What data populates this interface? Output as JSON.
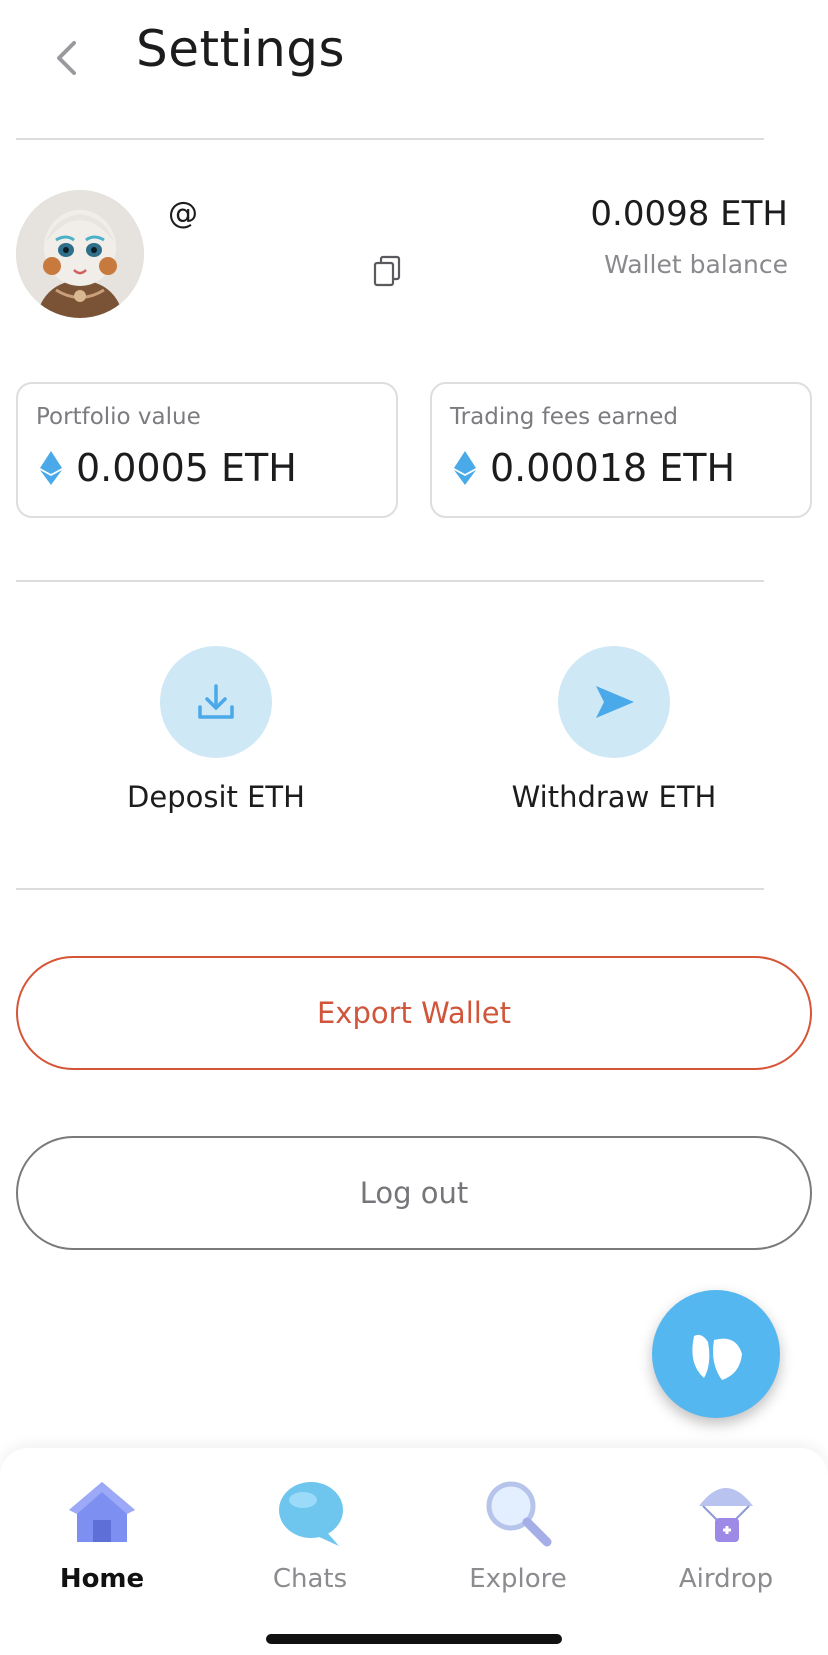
{
  "header": {
    "title": "Settings",
    "back_icon": "chevron-left-icon"
  },
  "profile": {
    "handle": "@",
    "avatar": "avatar-image",
    "copy_icon": "copy-icon",
    "balance_value": "0.0098 ETH",
    "balance_label": "Wallet balance"
  },
  "stats": [
    {
      "label": "Portfolio value",
      "value": "0.0005 ETH",
      "icon": "eth-icon"
    },
    {
      "label": "Trading fees earned",
      "value": "0.00018 ETH",
      "icon": "eth-icon"
    }
  ],
  "actions": {
    "deposit_label": "Deposit ETH",
    "deposit_icon": "download-icon",
    "withdraw_label": "Withdraw ETH",
    "withdraw_icon": "send-icon"
  },
  "buttons": {
    "export_label": "Export Wallet",
    "logout_label": "Log out"
  },
  "fab": {
    "icon": "app-logo-icon"
  },
  "tabbar": {
    "items": [
      {
        "label": "Home",
        "icon": "home-icon",
        "active": true
      },
      {
        "label": "Chats",
        "icon": "chat-bubble-icon",
        "active": false
      },
      {
        "label": "Explore",
        "icon": "magnifier-icon",
        "active": false
      },
      {
        "label": "Airdrop",
        "icon": "parachute-icon",
        "active": false
      }
    ]
  },
  "colors": {
    "accent_blue": "#55b7ef",
    "action_circle": "#cfe8f5",
    "export_red": "#d0553a",
    "divider": "#dcdcdc"
  }
}
